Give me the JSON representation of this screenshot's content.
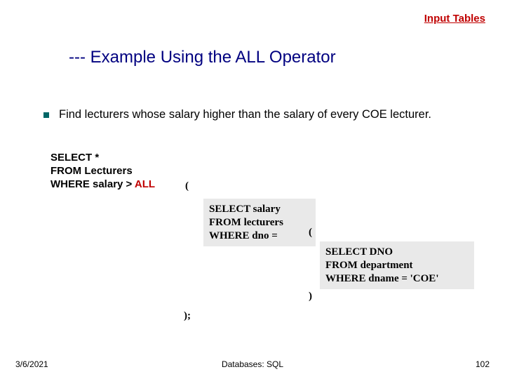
{
  "top_link": "Input Tables",
  "title": "--- Example Using the ALL Operator",
  "bullet": "Find lecturers whose salary higher than the salary of every COE lecturer.",
  "code": {
    "line1": "SELECT *",
    "line2": "FROM Lecturers",
    "line3_pre": "WHERE salary > ",
    "line3_all": "ALL",
    "paren_open": "(",
    "inner1_l1": "SELECT salary",
    "inner1_l2": "FROM lecturers",
    "inner1_l3": "WHERE dno =",
    "inner_paren_open": "(",
    "inner2_l1": "SELECT DNO",
    "inner2_l2": "FROM department",
    "inner2_l3": "WHERE dname = 'COE'",
    "inner_paren_close": ")",
    "closing": ");"
  },
  "footer": {
    "date": "3/6/2021",
    "center": "Databases: SQL",
    "page": "102"
  }
}
